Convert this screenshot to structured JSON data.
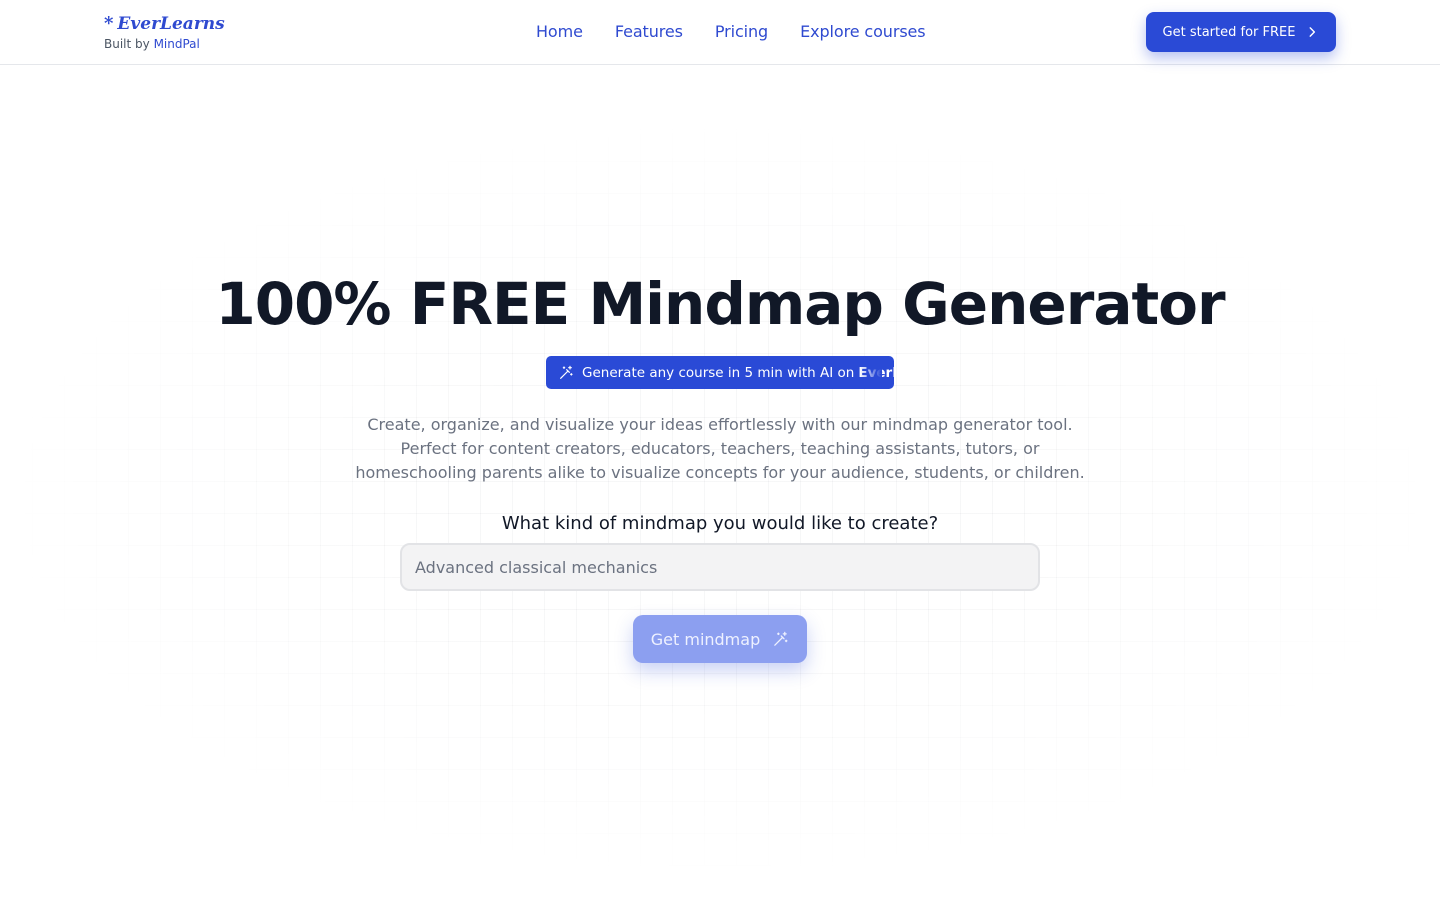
{
  "header": {
    "brand_star": "*",
    "brand_name": "EverLearns",
    "built_by_prefix": "Built by",
    "built_by_link": "MindPal",
    "nav": [
      {
        "label": "Home"
      },
      {
        "label": "Features"
      },
      {
        "label": "Pricing"
      },
      {
        "label": "Explore courses"
      }
    ],
    "cta_label": "Get started for FREE",
    "cta_icon": "chevron-right-icon"
  },
  "hero": {
    "title": "100% FREE Mindmap Generator",
    "badge_text": "Generate any course in 5 min with AI on",
    "badge_brand": "EverLe",
    "badge_icon": "magic-wand-icon",
    "description": "Create, organize, and visualize your ideas effortlessly with our mindmap generator tool. Perfect for content creators, educators, teachers, teaching assistants, tutors, or homeschooling parents alike to visualize concepts for your audience, students, or children.",
    "question": "What kind of mindmap you would like to create?",
    "input_placeholder": "Advanced classical mechanics",
    "input_value": "",
    "submit_label": "Get mindmap",
    "submit_icon": "magic-wand-icon"
  },
  "colors": {
    "accent": "#2a4ad6",
    "brand_text": "#2f4ad0",
    "submit_disabled": "#8c9ff0",
    "muted_text": "#6b7280"
  }
}
